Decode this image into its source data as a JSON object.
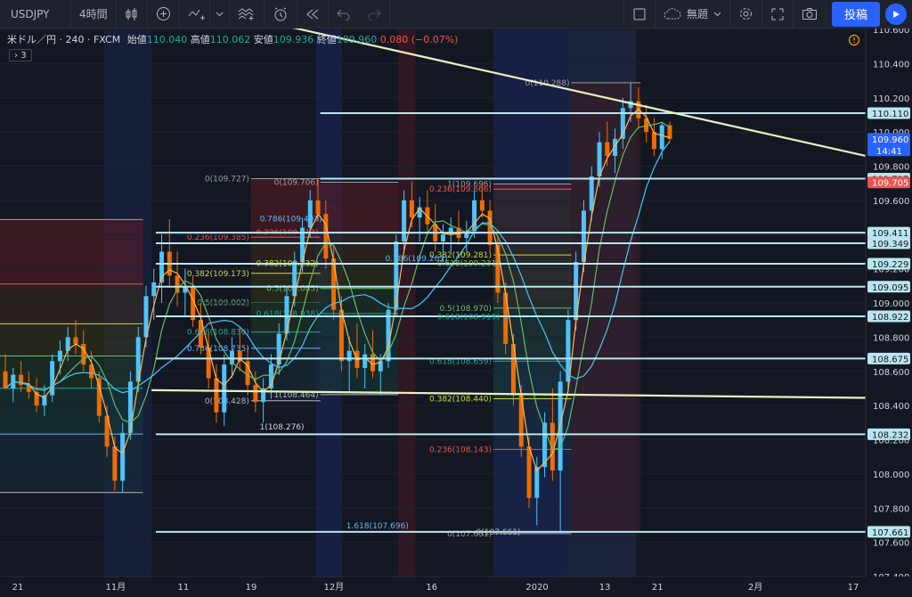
{
  "toolbar": {
    "symbol": "USDJPY",
    "interval": "4時間",
    "template_label": "無題",
    "publish_label": "投稿"
  },
  "legend": {
    "symbol_title": "米ドル／円 · 240 · FXCM",
    "open_label": "始値",
    "open": "110.040",
    "high_label": "高値",
    "high": "110.062",
    "low_label": "安値",
    "low": "109.936",
    "close_label": "終値",
    "close": "109.960",
    "change": "0.080 (−0.07%)",
    "collapse_count": "3"
  },
  "chart_data": {
    "type": "candlestick",
    "y_range": [
      107.4,
      110.6
    ],
    "y_ticks": [
      107.4,
      107.6,
      107.8,
      108.0,
      108.2,
      108.4,
      108.6,
      108.8,
      109.0,
      109.2,
      109.4,
      109.6,
      109.8,
      110.0,
      110.2,
      110.4,
      110.6
    ],
    "x_ticks": [
      {
        "label": "21",
        "pos": 0.0
      },
      {
        "label": "11月",
        "pos": 0.13
      },
      {
        "label": "11",
        "pos": 0.22
      },
      {
        "label": "19",
        "pos": 0.31
      },
      {
        "label": "12月",
        "pos": 0.42
      },
      {
        "label": "16",
        "pos": 0.55
      },
      {
        "label": "2020",
        "pos": 0.69
      },
      {
        "label": "13",
        "pos": 0.78
      },
      {
        "label": "21",
        "pos": 0.85
      },
      {
        "label": "2月",
        "pos": 0.98
      },
      {
        "label": "17",
        "pos": 1.11
      }
    ],
    "price_tags": [
      {
        "value": 110.11,
        "label": "110.110",
        "color": "#b9e6f0",
        "text": "#131722"
      },
      {
        "value": 109.96,
        "label": "109.960",
        "color": "#2962ff",
        "text": "#ffffff",
        "sub": "14:41"
      },
      {
        "value": 109.727,
        "label": "109.727",
        "color": "#b9e6f0",
        "text": "#131722"
      },
      {
        "value": 109.705,
        "label": "109.705",
        "color": "#ef5350",
        "text": "#ffffff"
      },
      {
        "value": 109.411,
        "label": "109.411",
        "color": "#b9e6f0",
        "text": "#131722"
      },
      {
        "value": 109.349,
        "label": "109.349",
        "color": "#b9e6f0",
        "text": "#131722"
      },
      {
        "value": 109.229,
        "label": "109.229",
        "color": "#b9e6f0",
        "text": "#131722"
      },
      {
        "value": 109.095,
        "label": "109.095",
        "color": "#b9e6f0",
        "text": "#131722"
      },
      {
        "value": 108.922,
        "label": "108.922",
        "color": "#b9e6f0",
        "text": "#131722"
      },
      {
        "value": 108.675,
        "label": "108.675",
        "color": "#b9e6f0",
        "text": "#131722"
      },
      {
        "value": 108.232,
        "label": "108.232",
        "color": "#b9e6f0",
        "text": "#131722"
      },
      {
        "value": 107.661,
        "label": "107.661",
        "color": "#b9e6f0",
        "text": "#131722"
      }
    ],
    "horizontal_lines": [
      110.11,
      109.727,
      109.411,
      109.349,
      109.229,
      109.095,
      108.922,
      108.675,
      108.232,
      107.661
    ],
    "trendlines": [
      {
        "x1": 0.33,
        "y1": 110.62,
        "x2": 1.0,
        "y2": 109.86
      },
      {
        "x1": 0.175,
        "y1": 108.49,
        "x2": 1.0,
        "y2": 108.445
      }
    ],
    "fib_zones": [
      {
        "x1": 0.0,
        "x2": 0.165,
        "top": 109.488,
        "bottom": 107.891,
        "dir": "down",
        "levels": [
          {
            "r": "0",
            "v": 109.488,
            "label": "0(109.488)"
          },
          {
            "r": "0.236",
            "v": 109.111,
            "label": "0.236(109.111)"
          },
          {
            "r": "0.382",
            "v": 108.878,
            "label": "0.382(108.878)"
          },
          {
            "r": "0.5",
            "v": 108.69,
            "label": "0.5(108.690)"
          },
          {
            "r": "0.618",
            "v": 108.501,
            "label": "0.618(108.501)"
          },
          {
            "r": "0.786",
            "v": 108.233,
            "label": "0.786(108.233)"
          },
          {
            "r": "1",
            "v": 107.891,
            "label": "1(107.891)"
          }
        ]
      },
      {
        "x1": 0.29,
        "x2": 0.37,
        "top": 109.727,
        "bottom": 108.428,
        "dir": "down",
        "levels": [
          {
            "r": "0",
            "v": 109.727,
            "label": "0(109.727)"
          },
          {
            "r": "0.236",
            "v": 109.385,
            "label": "0.236(109.385)"
          },
          {
            "r": "0.382",
            "v": 109.173,
            "label": "0.382(109.173)"
          },
          {
            "r": "0.5",
            "v": 109.002,
            "label": "0.5(109.002)"
          },
          {
            "r": "0.618",
            "v": 108.83,
            "label": "0.618(108.830)"
          },
          {
            "r": "0.786",
            "v": 108.735,
            "label": "0.786(108.735)"
          },
          {
            "r": "1",
            "v": 108.428,
            "label": "0(108.428)"
          }
        ]
      },
      {
        "x1": 0.37,
        "x2": 0.46,
        "top": 109.706,
        "bottom": 108.464,
        "dir": "down",
        "levels": [
          {
            "r": "0",
            "v": 109.706,
            "label": "0(109.706)"
          },
          {
            "r": "0.236",
            "v": 109.413,
            "label": "0.236(109.413)"
          },
          {
            "r": "0.382",
            "v": 109.232,
            "label": "0.382(109.232)"
          },
          {
            "r": "0.5",
            "v": 109.085,
            "label": "0.5(109.085)"
          },
          {
            "r": "0.618",
            "v": 108.938,
            "label": "0.618(108.938)"
          },
          {
            "r": "1",
            "v": 108.464,
            "label": "1(108.464)"
          }
        ]
      },
      {
        "x1": 0.57,
        "x2": 0.66,
        "top": 109.696,
        "bottom": 107.651,
        "dir": "down",
        "levels": [
          {
            "r": "0",
            "v": 109.696,
            "label": "1(109.696)"
          },
          {
            "r": "0.236",
            "v": 109.666,
            "label": "0.236(109.666)"
          },
          {
            "r": "0.382",
            "v": 109.281,
            "label": "0.382(109.281)"
          },
          {
            "r": "0.5",
            "v": 108.97,
            "label": "0.5(108.970)"
          },
          {
            "r": "0.618",
            "v": 108.659,
            "label": "0.618(108.659)"
          },
          {
            "r": "0.382b",
            "v": 108.44,
            "label": "0.382(108.440)"
          },
          {
            "r": "0.236b",
            "v": 108.143,
            "label": "0.236(108.143)"
          },
          {
            "r": "0",
            "v": 107.651,
            "label": "0(107.651)"
          }
        ]
      },
      {
        "x1": 0.66,
        "x2": 0.74,
        "top": 110.288,
        "bottom": 107.651,
        "dir": "down",
        "levels": [
          {
            "r": "0",
            "v": 110.288,
            "label": "0(110.288)"
          }
        ]
      }
    ],
    "extra_labels": [
      {
        "x": 0.505,
        "v": 109.231,
        "label": "0.618(109.231)",
        "color": "#8bc34a"
      },
      {
        "x": 0.505,
        "v": 108.919,
        "label": "0.618(108.919)",
        "color": "#26a69a"
      },
      {
        "x": 0.445,
        "v": 109.261,
        "label": "0.786(109.261)",
        "color": "#64b5f6"
      },
      {
        "x": 0.4,
        "v": 107.696,
        "label": "1.618(107.696)",
        "color": "#64b5f6"
      },
      {
        "x": 0.55,
        "v": 107.661,
        "label": "0(107.661)",
        "color": "#b2b5be"
      },
      {
        "x": 0.3,
        "v": 109.493,
        "label": "0.786(109.493)",
        "color": "#64b5f6"
      },
      {
        "x": 0.3,
        "v": 108.276,
        "label": "1(108.276)",
        "color": "#d1d4dc"
      }
    ],
    "candles": [
      [
        108.6,
        108.7,
        108.55,
        108.5
      ],
      [
        108.5,
        108.62,
        108.42,
        108.58
      ],
      [
        108.58,
        108.66,
        108.48,
        108.52
      ],
      [
        108.52,
        108.6,
        108.44,
        108.48
      ],
      [
        108.48,
        108.56,
        108.36,
        108.4
      ],
      [
        108.4,
        108.52,
        108.34,
        108.46
      ],
      [
        108.46,
        108.7,
        108.42,
        108.66
      ],
      [
        108.66,
        108.78,
        108.58,
        108.72
      ],
      [
        108.72,
        108.86,
        108.66,
        108.8
      ],
      [
        108.8,
        108.9,
        108.7,
        108.76
      ],
      [
        108.76,
        108.84,
        108.6,
        108.64
      ],
      [
        108.64,
        108.72,
        108.5,
        108.56
      ],
      [
        108.56,
        108.6,
        108.3,
        108.34
      ],
      [
        108.34,
        108.4,
        108.1,
        108.16
      ],
      [
        108.16,
        108.22,
        107.9,
        107.96
      ],
      [
        107.96,
        108.3,
        107.89,
        108.24
      ],
      [
        108.24,
        108.6,
        108.2,
        108.54
      ],
      [
        108.54,
        108.86,
        108.48,
        108.8
      ],
      [
        108.8,
        109.1,
        108.74,
        109.04
      ],
      [
        109.04,
        109.2,
        108.9,
        109.12
      ],
      [
        109.12,
        109.4,
        109.0,
        109.3
      ],
      [
        109.3,
        109.49,
        109.1,
        109.16
      ],
      [
        109.16,
        109.3,
        108.98,
        109.06
      ],
      [
        109.06,
        109.2,
        108.92,
        109.1
      ],
      [
        109.1,
        109.16,
        108.86,
        108.9
      ],
      [
        108.9,
        109.0,
        108.7,
        108.74
      ],
      [
        108.74,
        108.82,
        108.5,
        108.56
      ],
      [
        108.56,
        108.64,
        108.3,
        108.36
      ],
      [
        108.36,
        108.7,
        108.28,
        108.64
      ],
      [
        108.64,
        108.8,
        108.56,
        108.72
      ],
      [
        108.72,
        108.86,
        108.6,
        108.66
      ],
      [
        108.66,
        108.74,
        108.46,
        108.52
      ],
      [
        108.52,
        108.6,
        108.36,
        108.42
      ],
      [
        108.42,
        108.56,
        108.3,
        108.5
      ],
      [
        108.5,
        108.7,
        108.44,
        108.64
      ],
      [
        108.64,
        108.88,
        108.58,
        108.82
      ],
      [
        108.82,
        109.1,
        108.78,
        109.04
      ],
      [
        109.04,
        109.3,
        108.98,
        109.24
      ],
      [
        109.24,
        109.5,
        109.18,
        109.44
      ],
      [
        109.44,
        109.66,
        109.38,
        109.6
      ],
      [
        109.6,
        109.73,
        109.48,
        109.52
      ],
      [
        109.52,
        109.6,
        109.2,
        109.26
      ],
      [
        109.26,
        109.34,
        108.9,
        108.96
      ],
      [
        108.96,
        109.04,
        108.6,
        108.66
      ],
      [
        108.66,
        108.8,
        108.48,
        108.72
      ],
      [
        108.72,
        108.88,
        108.56,
        108.62
      ],
      [
        108.62,
        108.76,
        108.5,
        108.7
      ],
      [
        108.7,
        108.84,
        108.56,
        108.6
      ],
      [
        108.6,
        108.7,
        108.46,
        108.66
      ],
      [
        108.66,
        109.0,
        108.62,
        108.96
      ],
      [
        108.96,
        109.4,
        108.92,
        109.36
      ],
      [
        109.36,
        109.66,
        109.3,
        109.6
      ],
      [
        109.6,
        109.71,
        109.44,
        109.5
      ],
      [
        109.5,
        109.62,
        109.36,
        109.56
      ],
      [
        109.56,
        109.66,
        109.4,
        109.46
      ],
      [
        109.46,
        109.58,
        109.3,
        109.36
      ],
      [
        109.36,
        109.46,
        109.24,
        109.4
      ],
      [
        109.4,
        109.5,
        109.3,
        109.44
      ],
      [
        109.44,
        109.54,
        109.34,
        109.38
      ],
      [
        109.38,
        109.48,
        109.3,
        109.42
      ],
      [
        109.42,
        109.66,
        109.38,
        109.6
      ],
      [
        109.6,
        109.7,
        109.5,
        109.54
      ],
      [
        109.54,
        109.6,
        109.3,
        109.34
      ],
      [
        109.34,
        109.4,
        109.0,
        109.06
      ],
      [
        109.06,
        109.12,
        108.7,
        108.76
      ],
      [
        108.76,
        108.82,
        108.4,
        108.46
      ],
      [
        108.46,
        108.52,
        108.1,
        108.16
      ],
      [
        108.16,
        108.22,
        107.8,
        107.86
      ],
      [
        107.86,
        108.1,
        107.7,
        108.04
      ],
      [
        108.04,
        108.36,
        107.98,
        108.3
      ],
      [
        108.3,
        108.5,
        107.96,
        108.02
      ],
      [
        108.02,
        108.6,
        107.66,
        108.54
      ],
      [
        108.54,
        108.96,
        108.5,
        108.9
      ],
      [
        108.9,
        109.3,
        108.84,
        109.24
      ],
      [
        109.24,
        109.6,
        109.18,
        109.54
      ],
      [
        109.54,
        109.8,
        109.48,
        109.74
      ],
      [
        109.74,
        110.0,
        109.68,
        109.94
      ],
      [
        109.94,
        110.06,
        109.8,
        109.86
      ],
      [
        109.86,
        110.02,
        109.76,
        109.96
      ],
      [
        109.96,
        110.2,
        109.9,
        110.14
      ],
      [
        110.14,
        110.29,
        110.06,
        110.18
      ],
      [
        110.18,
        110.26,
        110.02,
        110.08
      ],
      [
        110.08,
        110.16,
        109.94,
        110.0
      ],
      [
        110.0,
        110.08,
        109.86,
        109.9
      ],
      [
        109.9,
        110.06,
        109.84,
        110.04
      ],
      [
        110.04,
        110.06,
        109.94,
        109.96
      ]
    ]
  }
}
